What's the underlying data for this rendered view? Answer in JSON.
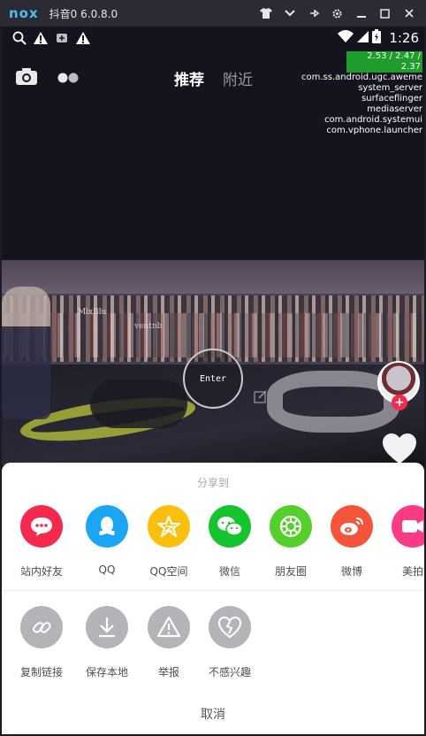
{
  "emulator": {
    "logo": "nox",
    "title": "抖音0 6.0.8.0",
    "controls": [
      "shirt-icon",
      "chevron-down-icon",
      "pin-icon",
      "gear-icon",
      "minimize-icon",
      "maximize-icon",
      "close-icon"
    ]
  },
  "status_bar": {
    "time": "1:26"
  },
  "overlay": {
    "meter": "2.53 / 2.47 / 2.37",
    "processes": [
      "com.ss.android.ugc.aweme",
      "system_server",
      "surfaceflinger",
      "mediaserver",
      "com.android.systemui",
      "com.vphone.launcher"
    ]
  },
  "top_nav": {
    "tab_recommend": "推荐",
    "tab_nearby": "附近"
  },
  "video": {
    "enter_label": "Enter",
    "banner_1": "MixBlu",
    "banner_2": "ventnb"
  },
  "share_sheet": {
    "title": "分享到",
    "row1": [
      {
        "label": "站内好友",
        "icon": "chat-bubble-icon",
        "color": "#f5284e"
      },
      {
        "label": "QQ",
        "icon": "qq-penguin-icon",
        "color": "#1aa5f5"
      },
      {
        "label": "QQ空间",
        "icon": "qzone-star-icon",
        "color": "#fbbf0e"
      },
      {
        "label": "微信",
        "icon": "wechat-icon",
        "color": "#16c42d"
      },
      {
        "label": "朋友圈",
        "icon": "moments-icon",
        "color": "#54d02a"
      },
      {
        "label": "微博",
        "icon": "weibo-icon",
        "color": "#f4553a"
      },
      {
        "label": "美拍",
        "icon": "meipai-camera-icon",
        "color": "#fb3b86"
      }
    ],
    "row2": [
      {
        "label": "复制链接",
        "icon": "link-icon",
        "color": "#b3b3b8"
      },
      {
        "label": "保存本地",
        "icon": "download-icon",
        "color": "#b3b3b8"
      },
      {
        "label": "举报",
        "icon": "warning-icon",
        "color": "#b3b3b8"
      },
      {
        "label": "不感兴趣",
        "icon": "broken-heart-icon",
        "color": "#b3b3b8"
      }
    ],
    "cancel": "取消"
  }
}
